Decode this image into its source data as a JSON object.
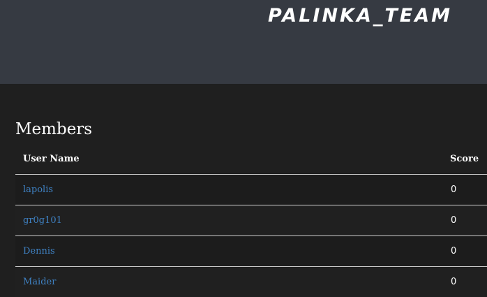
{
  "team": {
    "name": "PALINKA_TEAM"
  },
  "members": {
    "heading": "Members",
    "columns": {
      "user_name": "User Name",
      "score": "Score"
    },
    "rows": [
      {
        "user": "lapolis",
        "score": "0"
      },
      {
        "user": "gr0g101",
        "score": "0"
      },
      {
        "user": "Dennis",
        "score": "0"
      },
      {
        "user": "Maider",
        "score": "0"
      }
    ]
  },
  "colors": {
    "header_background": "#363a42",
    "page_background": "#1f1f1f",
    "link": "#3f82c4",
    "text": "#ffffff",
    "row_divider": "#cfcfcf"
  }
}
